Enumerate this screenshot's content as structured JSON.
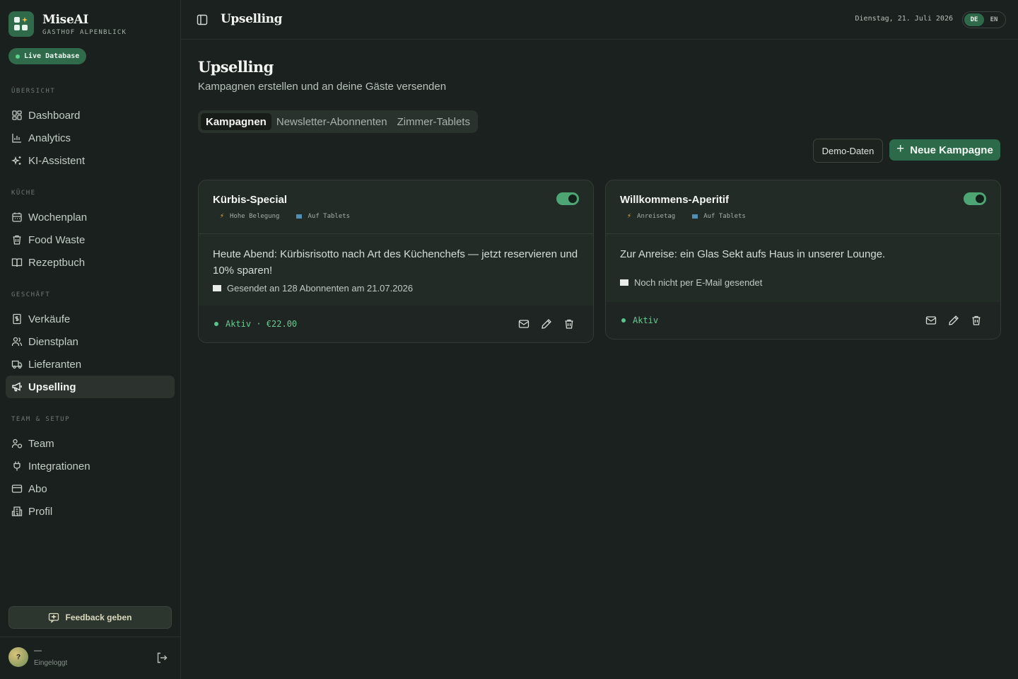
{
  "brand": {
    "name": "MiseAI",
    "subtitle": "GASTHOF ALPENBLICK",
    "badge": "Live Database"
  },
  "sidebar": {
    "sections": [
      {
        "label": "ÜBERSICHT",
        "items": [
          {
            "label": "Dashboard",
            "icon": "grid-icon"
          },
          {
            "label": "Analytics",
            "icon": "bar-chart-icon"
          },
          {
            "label": "KI-Assistent",
            "icon": "sparkles-icon"
          }
        ]
      },
      {
        "label": "KÜCHE",
        "items": [
          {
            "label": "Wochenplan",
            "icon": "calendar-icon"
          },
          {
            "label": "Food Waste",
            "icon": "trash-icon"
          },
          {
            "label": "Rezeptbuch",
            "icon": "book-icon"
          }
        ]
      },
      {
        "label": "GESCHÄFT",
        "items": [
          {
            "label": "Verkäufe",
            "icon": "receipt-icon"
          },
          {
            "label": "Dienstplan",
            "icon": "users-icon"
          },
          {
            "label": "Lieferanten",
            "icon": "truck-icon"
          },
          {
            "label": "Upselling",
            "icon": "megaphone-icon",
            "active": true
          }
        ]
      },
      {
        "label": "TEAM & SETUP",
        "items": [
          {
            "label": "Team",
            "icon": "user-group-icon"
          },
          {
            "label": "Integrationen",
            "icon": "plug-icon"
          },
          {
            "label": "Abo",
            "icon": "credit-card-icon"
          },
          {
            "label": "Profil",
            "icon": "building-icon"
          }
        ]
      }
    ],
    "feedback_label": "Feedback geben",
    "user": {
      "avatar_initial": "?",
      "name": "—",
      "status": "Eingeloggt"
    }
  },
  "topbar": {
    "title": "Upselling",
    "date": "Dienstag, 21. Juli 2026",
    "languages": [
      {
        "code": "DE",
        "active": true
      },
      {
        "code": "EN",
        "active": false
      }
    ]
  },
  "page": {
    "title": "Upselling",
    "subtitle": "Kampagnen erstellen und an deine Gäste versenden",
    "tabs": [
      {
        "label": "Kampagnen",
        "active": true
      },
      {
        "label": "Newsletter-Abonnenten",
        "active": false
      },
      {
        "label": "Zimmer-Tablets",
        "active": false
      }
    ],
    "demo_button": "Demo-Daten",
    "new_button": "Neue Kampagne"
  },
  "campaigns": [
    {
      "title": "Kürbis-Special",
      "trigger": "Hohe Belegung",
      "channel": "Auf Tablets",
      "enabled": true,
      "message": "Heute Abend: Kürbisrisotto nach Art des Küchenchefs — jetzt reservieren und 10% sparen!",
      "sent_info": "Gesendet an 128 Abonnenten am 21.07.2026",
      "status": "Aktiv · €22.00"
    },
    {
      "title": "Willkommens-Aperitif",
      "trigger": "Anreisetag",
      "channel": "Auf Tablets",
      "enabled": true,
      "message": "Zur Anreise: ein Glas Sekt aufs Haus in unserer Lounge.",
      "sent_info": "Noch nicht per E-Mail gesendet",
      "status": "Aktiv"
    }
  ],
  "colors": {
    "accent": "#2f6a4a",
    "toggle_on": "#4ea574",
    "status_active": "#6fc895",
    "background": "#1b211e"
  }
}
